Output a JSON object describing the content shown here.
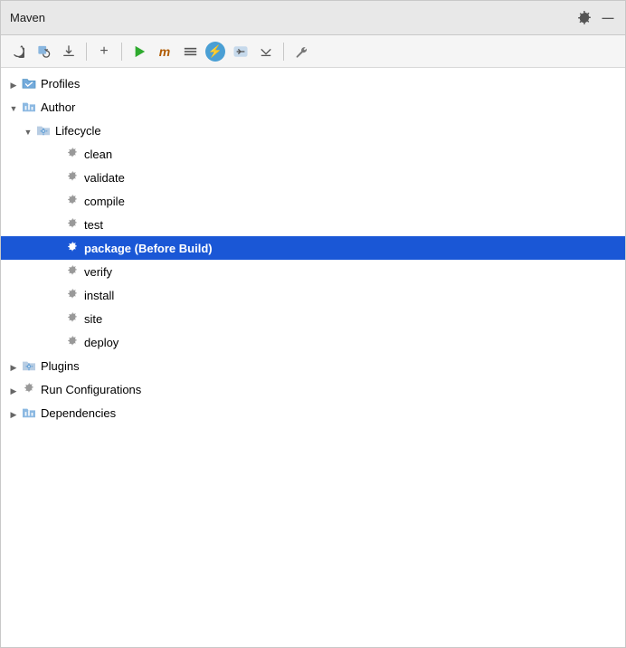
{
  "panel": {
    "title": "Maven",
    "title_bar_icons": [
      {
        "name": "settings-icon",
        "glyph": "⚙"
      },
      {
        "name": "minimize-icon",
        "glyph": "—"
      }
    ]
  },
  "toolbar": {
    "buttons": [
      {
        "name": "refresh-button",
        "glyph": "↻",
        "tooltip": "Reload"
      },
      {
        "name": "reload-project-button",
        "glyph": "⟳",
        "tooltip": "Reload Project"
      },
      {
        "name": "download-button",
        "glyph": "⬇",
        "tooltip": "Download Sources"
      },
      {
        "name": "add-button",
        "glyph": "+",
        "tooltip": "Add"
      },
      {
        "name": "run-button",
        "glyph": "▶",
        "tooltip": "Run",
        "special": "play"
      },
      {
        "name": "maven-button",
        "glyph": "m",
        "tooltip": "Maven",
        "special": "maven"
      },
      {
        "name": "toggle-button",
        "glyph": "⊞",
        "tooltip": "Toggle"
      },
      {
        "name": "lightning-button",
        "glyph": "⚡",
        "tooltip": "Execute",
        "special": "lightning"
      },
      {
        "name": "skip-test-button",
        "glyph": "⇅",
        "tooltip": "Skip Tests"
      },
      {
        "name": "collapse-button",
        "glyph": "⇊",
        "tooltip": "Collapse"
      },
      {
        "name": "wrench-button",
        "glyph": "🔧",
        "tooltip": "Settings"
      }
    ]
  },
  "tree": {
    "items": [
      {
        "id": "profiles",
        "label": "Profiles",
        "indent": 1,
        "type": "folder-check",
        "toggle": "▶",
        "expanded": false,
        "selected": false
      },
      {
        "id": "author",
        "label": "Author",
        "indent": 1,
        "type": "folder-bar",
        "toggle": "▼",
        "expanded": true,
        "selected": false
      },
      {
        "id": "lifecycle",
        "label": "Lifecycle",
        "indent": 2,
        "type": "folder-gear",
        "toggle": "▼",
        "expanded": true,
        "selected": false
      },
      {
        "id": "clean",
        "label": "clean",
        "indent": 4,
        "type": "gear",
        "toggle": "",
        "expanded": false,
        "selected": false
      },
      {
        "id": "validate",
        "label": "validate",
        "indent": 4,
        "type": "gear",
        "toggle": "",
        "expanded": false,
        "selected": false
      },
      {
        "id": "compile",
        "label": "compile",
        "indent": 4,
        "type": "gear",
        "toggle": "",
        "expanded": false,
        "selected": false
      },
      {
        "id": "test",
        "label": "test",
        "indent": 4,
        "type": "gear",
        "toggle": "",
        "expanded": false,
        "selected": false
      },
      {
        "id": "package",
        "label": "package (Before Build)",
        "indent": 4,
        "type": "gear",
        "toggle": "",
        "expanded": false,
        "selected": true
      },
      {
        "id": "verify",
        "label": "verify",
        "indent": 4,
        "type": "gear",
        "toggle": "",
        "expanded": false,
        "selected": false
      },
      {
        "id": "install",
        "label": "install",
        "indent": 4,
        "type": "gear",
        "toggle": "",
        "expanded": false,
        "selected": false
      },
      {
        "id": "site",
        "label": "site",
        "indent": 4,
        "type": "gear",
        "toggle": "",
        "expanded": false,
        "selected": false
      },
      {
        "id": "deploy",
        "label": "deploy",
        "indent": 4,
        "type": "gear",
        "toggle": "",
        "expanded": false,
        "selected": false
      },
      {
        "id": "plugins",
        "label": "Plugins",
        "indent": 1,
        "type": "folder-gear",
        "toggle": "▶",
        "expanded": false,
        "selected": false
      },
      {
        "id": "run-configs",
        "label": "Run Configurations",
        "indent": 1,
        "type": "gear",
        "toggle": "▶",
        "expanded": false,
        "selected": false
      },
      {
        "id": "dependencies",
        "label": "Dependencies",
        "indent": 1,
        "type": "folder-bar2",
        "toggle": "▶",
        "expanded": false,
        "selected": false
      }
    ]
  },
  "colors": {
    "selected_bg": "#1a57d6",
    "gear_color": "#999",
    "folder_blue": "#5b9bd5",
    "folder_teal": "#4db8b8"
  }
}
